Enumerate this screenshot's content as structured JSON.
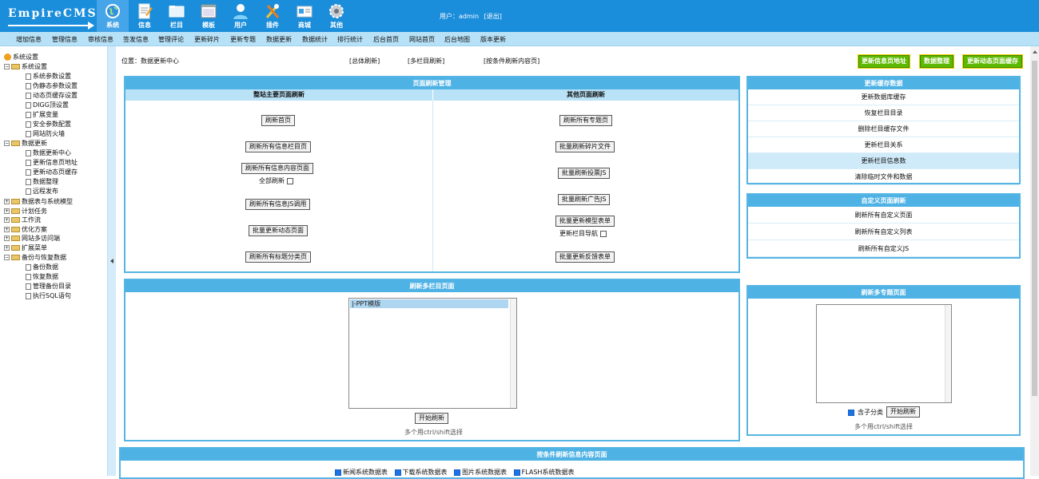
{
  "header": {
    "logo": "EmpireCMS",
    "nav": [
      {
        "label": "系统",
        "icon": "globe-icon"
      },
      {
        "label": "信息",
        "icon": "document-icon"
      },
      {
        "label": "栏目",
        "icon": "folder-icon"
      },
      {
        "label": "模板",
        "icon": "template-icon"
      },
      {
        "label": "用户",
        "icon": "user-icon"
      },
      {
        "label": "插件",
        "icon": "tools-icon"
      },
      {
        "label": "商城",
        "icon": "shop-card-icon"
      },
      {
        "label": "其他",
        "icon": "gear-icon"
      }
    ],
    "user_label": "用户：admin",
    "logout": "[退出]"
  },
  "subnav": [
    "增加信息",
    "管理信息",
    "审核信息",
    "签发信息",
    "管理评论",
    "更新碎片",
    "更新专题",
    "数据更新",
    "数据统计",
    "排行统计",
    "后台首页",
    "网站首页",
    "后台地图",
    "版本更新"
  ],
  "sidebar": {
    "root": "系统设置",
    "groups": [
      {
        "label": "系统设置",
        "items": [
          "系统参数设置",
          "伪静态参数设置",
          "动态页缓存设置",
          "DIGG顶设置",
          "扩展变量",
          "安全参数配置",
          "网站防火墙"
        ]
      },
      {
        "label": "数据更新",
        "items": [
          "数据更新中心",
          "更新信息页地址",
          "更新动态页缓存",
          "数据整理",
          "远程发布"
        ]
      },
      {
        "label": "数据表与系统模型",
        "items": []
      },
      {
        "label": "计划任务",
        "items": []
      },
      {
        "label": "工作流",
        "items": []
      },
      {
        "label": "优化方案",
        "items": []
      },
      {
        "label": "网站多访问端",
        "items": []
      },
      {
        "label": "扩展菜单",
        "items": []
      },
      {
        "label": "备份与恢复数据",
        "items": [
          "备份数据",
          "恢复数据",
          "管理备份目录",
          "执行SQL语句"
        ]
      }
    ]
  },
  "main": {
    "location": "位置：数据更新中心",
    "links": [
      "[总体刷新]",
      "[多栏目刷新]",
      "[按条件刷新内容页]"
    ],
    "top_buttons": [
      "更新信息页地址",
      "数据整理",
      "更新动态页面缓存"
    ],
    "page_refresh": {
      "title": "页面刷新管理",
      "left_title": "整站主要页面刷新",
      "right_title": "其他页面刷新",
      "left_buttons": [
        "刷新首页",
        "刷新所有信息栏目页",
        "刷新所有信息内容页面",
        "刷新所有信息JS调用",
        "批量更新动态页面",
        "刷新所有标题分类页"
      ],
      "left_check": "全部刷新",
      "right_buttons": [
        "刷新所有专题页",
        "批量刷新碎片文件",
        "批量刷新投票JS",
        "批量刷新广告JS",
        "批量更新模型表单",
        "批量更新反馈表单"
      ],
      "right_check": "更新栏目导航"
    },
    "cache": {
      "title": "更新缓存数据",
      "items": [
        "更新数据库缓存",
        "恢复栏目目录",
        "删除栏目缓存文件",
        "更新栏目关系",
        "更新栏目信息数",
        "清除临时文件和数据"
      ]
    },
    "custom": {
      "title": "自定义页面刷新",
      "items": [
        "刷新所有自定义页面",
        "刷新所有自定义列表",
        "刷新所有自定义JS"
      ]
    },
    "multi_column": {
      "title": "刷新多栏目页面",
      "options": [
        "|-PPT模版"
      ],
      "button": "开始刷新",
      "hint": "多个用ctrl/shift选择"
    },
    "multi_special": {
      "title": "刷新多专题页面",
      "check": "含子分类",
      "button": "开始刷新",
      "hint": "多个用ctrl/shift选择"
    },
    "conditional": {
      "title": "按条件刷新信息内容页面",
      "tables": [
        "新闻系统数据表",
        "下载系统数据表",
        "图片系统数据表",
        "FLASH系统数据表"
      ]
    }
  },
  "colors": {
    "header": "#1a8ddb",
    "panel_header": "#4eb2e5",
    "subnav": "#b7e1f7",
    "green_button": "#5cb800"
  }
}
